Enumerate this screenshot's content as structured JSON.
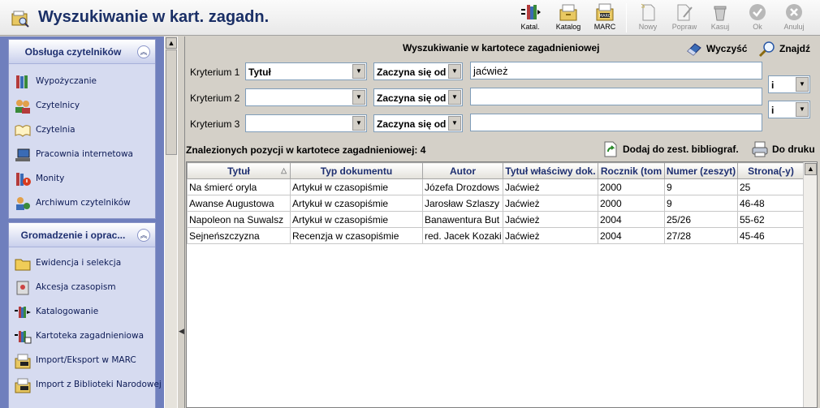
{
  "window": {
    "title": "Wyszukiwanie w kart. zagadn."
  },
  "toolbar": {
    "buttons": [
      {
        "label": "Katal.",
        "icon": "catalog-books-icon",
        "enabled": true
      },
      {
        "label": "Katalog",
        "icon": "catalog-drawer-icon",
        "enabled": true
      },
      {
        "label": "MARC",
        "icon": "marc-drawer-icon",
        "enabled": true
      },
      {
        "label": "Nowy",
        "icon": "new-document-icon",
        "enabled": false
      },
      {
        "label": "Popraw",
        "icon": "edit-document-icon",
        "enabled": false
      },
      {
        "label": "Kasuj",
        "icon": "trash-icon",
        "enabled": false
      },
      {
        "label": "Ok",
        "icon": "check-icon",
        "enabled": false
      },
      {
        "label": "Anuluj",
        "icon": "cancel-icon",
        "enabled": false
      }
    ]
  },
  "sidebar": {
    "panels": [
      {
        "title": "Obsługa czytelników",
        "items": [
          {
            "label": "Wypożyczanie",
            "icon": "books-icon"
          },
          {
            "label": "Czytelnicy",
            "icon": "users-icon"
          },
          {
            "label": "Czytelnia",
            "icon": "open-book-icon"
          },
          {
            "label": "Pracownia internetowa",
            "icon": "computer-icon"
          },
          {
            "label": "Monity",
            "icon": "warning-books-icon"
          },
          {
            "label": "Archiwum czytelników",
            "icon": "archive-users-icon"
          }
        ]
      },
      {
        "title": "Gromadzenie i oprac...",
        "items": [
          {
            "label": "Ewidencja i selekcja",
            "icon": "folder-icon"
          },
          {
            "label": "Akcesja czasopism",
            "icon": "journal-icon"
          },
          {
            "label": "Katalogowanie",
            "icon": "cataloguing-icon"
          },
          {
            "label": "Kartoteka zagadnieniowa",
            "icon": "subject-file-icon"
          },
          {
            "label": "Import/Eksport w MARC",
            "icon": "marc-import-icon"
          },
          {
            "label": "Import z Biblioteki Narodowej",
            "icon": "bn-import-icon"
          }
        ]
      }
    ]
  },
  "search": {
    "title": "Wyszukiwanie w kartotece zagadnieniowej",
    "clear_label": "Wyczyść",
    "find_label": "Znajdź",
    "criteria": [
      {
        "label": "Kryterium 1",
        "field": "Tytuł",
        "mode": "Zaczyna się od",
        "value": "jaćwież"
      },
      {
        "label": "Kryterium 2",
        "field": "",
        "mode": "Zaczyna się od",
        "value": ""
      },
      {
        "label": "Kryterium 3",
        "field": "",
        "mode": "Zaczyna się od",
        "value": ""
      }
    ],
    "operators": [
      "i",
      "i"
    ]
  },
  "results": {
    "count_label": "Znalezionych pozycji w kartotece zagadnieniowej: 4",
    "add_bibliography_label": "Dodaj do zest. bibliograf.",
    "print_label": "Do druku",
    "columns": [
      "Tytuł",
      "Typ dokumentu",
      "Autor",
      "Tytuł właściwy dok.",
      "Rocznik (tom",
      "Numer (zeszyt)",
      "Strona(-y)"
    ],
    "rows": [
      [
        "Na śmierć oryla",
        "Artykuł w czasopiśmie",
        "Józefa Drozdows",
        "Jaćwież",
        "2000",
        "9",
        "25"
      ],
      [
        "Awanse Augustowa",
        "Artykuł w czasopiśmie",
        "Jarosław Szlaszy",
        "Jaćwież",
        "2000",
        "9",
        "46-48"
      ],
      [
        "Napoleon na Suwalsz",
        "Artykuł w czasopiśmie",
        "Banawentura But",
        "Jaćwież",
        "2004",
        "25/26",
        "55-62"
      ],
      [
        "Sejneńszczyzna",
        "Recenzja w czasopiśmie",
        "red. Jacek Kozaki",
        "Jaćwież",
        "2004",
        "27/28",
        "45-46"
      ]
    ]
  }
}
